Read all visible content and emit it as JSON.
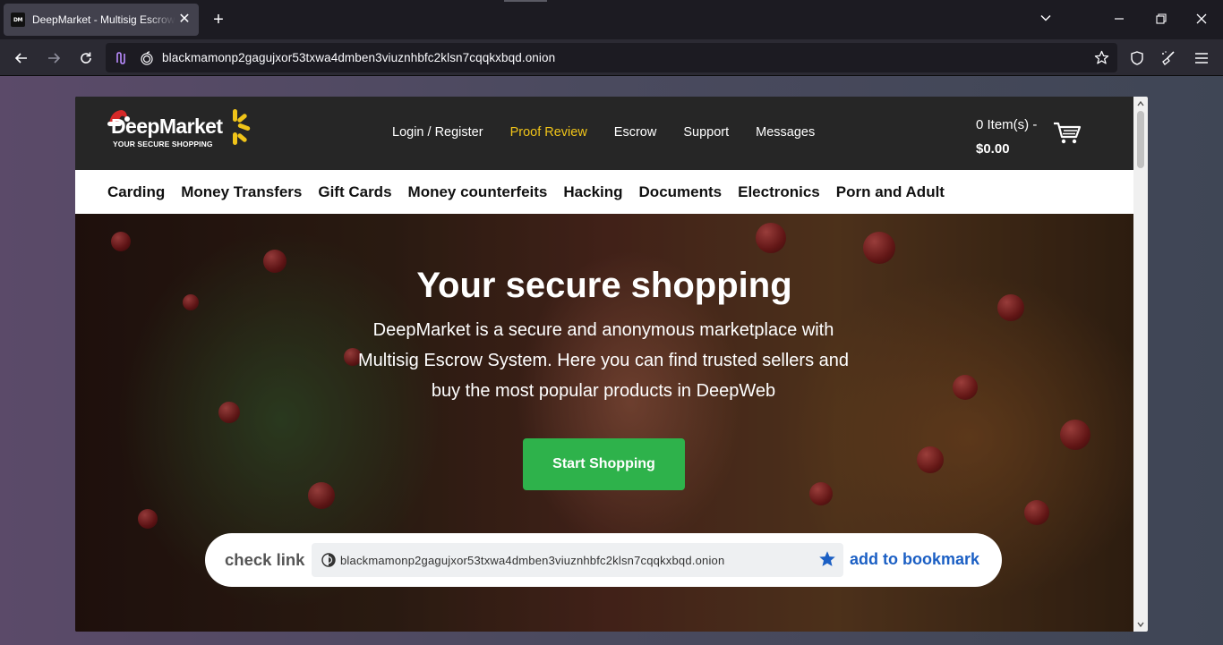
{
  "browser": {
    "tab_title": "DeepMarket - Multisig Escrow M",
    "favicon_text": "DM",
    "url": "blackmamonp2gagujxor53txwa4dmben3viuznhbfc2klsn7cqqkxbqd.onion",
    "icons": [
      "close-icon",
      "plus-icon",
      "chevron-down-icon",
      "minimize-icon",
      "restore-icon",
      "close-window-icon",
      "back-icon",
      "forward-icon",
      "reload-icon",
      "tor-circuit-icon",
      "onion-icon",
      "star-icon",
      "shield-icon",
      "broom-icon",
      "menu-icon"
    ]
  },
  "site": {
    "logo": {
      "name": "DeepMarket",
      "tagline": "YOUR SECURE SHOPPING"
    },
    "topnav": [
      {
        "label": "Login / Register",
        "active": false
      },
      {
        "label": "Proof Review",
        "active": true
      },
      {
        "label": "Escrow",
        "active": false
      },
      {
        "label": "Support",
        "active": false
      },
      {
        "label": "Messages",
        "active": false
      }
    ],
    "cart": {
      "items": "0 Item(s) -",
      "total": "$0.00"
    },
    "categories": [
      "Carding",
      "Money Transfers",
      "Gift Cards",
      "Money counterfeits",
      "Hacking",
      "Documents",
      "Electronics",
      "Porn and Adult"
    ],
    "hero": {
      "title": "Your secure shopping",
      "text": "DeepMarket is a secure and anonymous marketplace with Multisig Escrow System. Here you can find trusted sellers and buy the most popular products in DeepWeb",
      "cta": "Start Shopping"
    },
    "checklink": {
      "label": "check link",
      "url": "blackmamonp2gagujxor53txwa4dmben3viuznhbfc2klsn7cqqkxbqd.onion",
      "bookmark": "add to bookmark"
    }
  },
  "colors": {
    "accent_yellow": "#f0c419",
    "cta_green": "#2eb24b",
    "link_blue": "#1b5fc4",
    "header_dark": "#262626"
  }
}
